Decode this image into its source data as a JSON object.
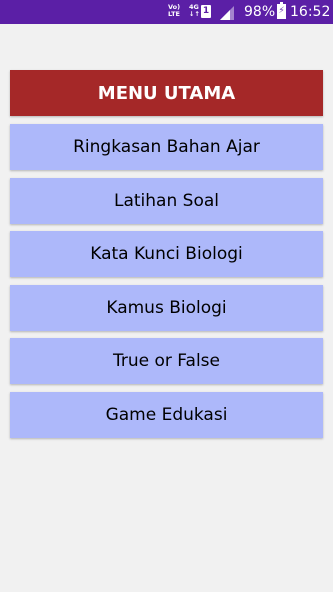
{
  "status_bar": {
    "network_top": "Vo)",
    "network_bottom": "LTE",
    "net_type_top": "4G",
    "net_type_bottom": "↓↑",
    "sim_slot": "1",
    "signal_icon": "signal-icon",
    "battery_percent": "98%",
    "battery_icon": "battery-charging-icon",
    "time": "16:52",
    "background_color": "#5b1fa6"
  },
  "menu": {
    "title": "MENU UTAMA",
    "header_color": "#a52828",
    "item_color": "#adb8fa",
    "items": [
      {
        "label": "Ringkasan Bahan Ajar"
      },
      {
        "label": "Latihan Soal"
      },
      {
        "label": "Kata Kunci Biologi"
      },
      {
        "label": "Kamus Biologi"
      },
      {
        "label": "True or False"
      },
      {
        "label": "Game Edukasi"
      }
    ]
  }
}
